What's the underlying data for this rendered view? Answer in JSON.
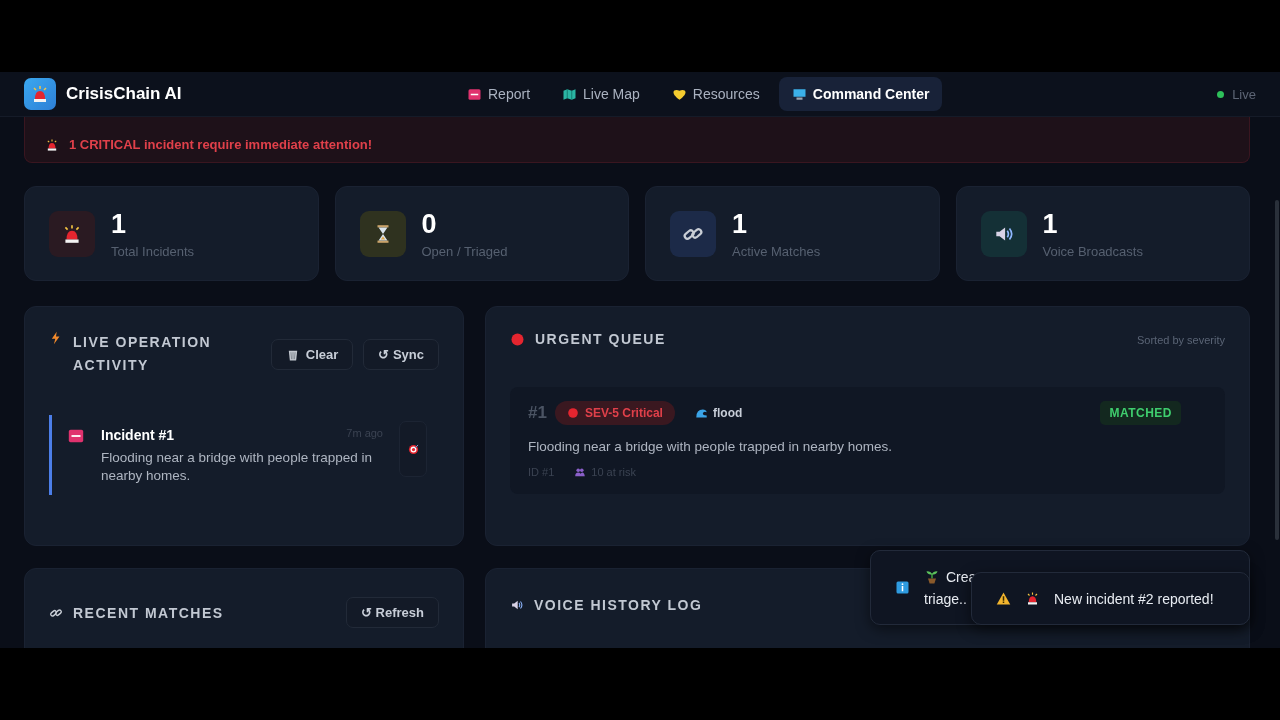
{
  "app": {
    "name": "CrisisChain AI"
  },
  "nav": [
    {
      "label": "Report",
      "selected": false
    },
    {
      "label": "Live Map",
      "selected": false
    },
    {
      "label": "Resources",
      "selected": false
    },
    {
      "label": "Command Center",
      "selected": true
    }
  ],
  "status": {
    "label": "Live",
    "on": true
  },
  "alert": {
    "text": "1 CRITICAL incident require immediate attention!"
  },
  "stats": [
    {
      "value": "1",
      "label": "Total Incidents"
    },
    {
      "value": "0",
      "label": "Open / Triaged"
    },
    {
      "value": "1",
      "label": "Active Matches"
    },
    {
      "value": "1",
      "label": "Voice Broadcasts"
    }
  ],
  "activity": {
    "title": "LIVE OPERATION ACTIVITY",
    "buttons": [
      "Clear",
      "↺ Sync"
    ],
    "items": [
      {
        "title": "Incident #1",
        "time": "7m ago",
        "text": "Flooding near a bridge with people trapped in nearby homes."
      }
    ]
  },
  "queue": {
    "title": "URGENT QUEUE",
    "note": "Sorted by severity",
    "items": [
      {
        "rank": "#1",
        "severity": "SEV-5 Critical",
        "type": "flood",
        "status": "MATCHED",
        "text": "Flooding near a bridge with people trapped in nearby homes.",
        "id": "ID #1",
        "at_risk": "10 at risk"
      }
    ]
  },
  "matches": {
    "title": "RECENT MATCHES",
    "button": "↺ Refresh"
  },
  "voice_log": {
    "title": "VOICE HISTORY LOG"
  },
  "toasts": [
    {
      "kind": "info",
      "lines": [
        "Crea",
        "triage.."
      ]
    },
    {
      "kind": "warning",
      "text": "New incident #2 reported!"
    }
  ]
}
